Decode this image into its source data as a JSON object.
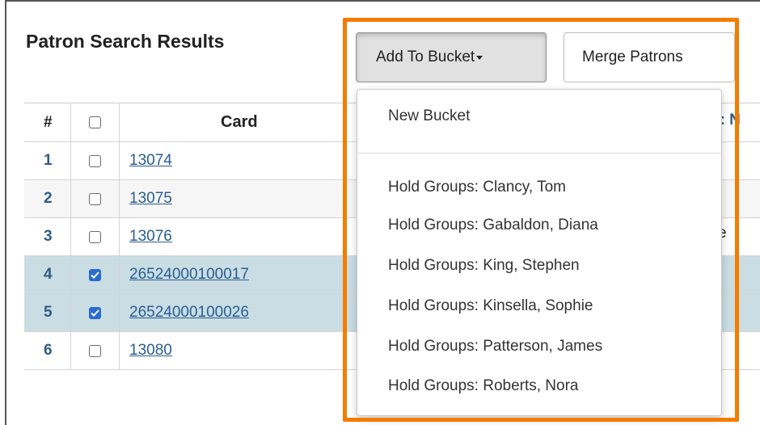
{
  "page": {
    "title": "Patron Search Results"
  },
  "toolbar": {
    "add_to_bucket_label": "Add To Bucket",
    "merge_patrons_label": "Merge Patrons"
  },
  "table": {
    "headers": {
      "num": "#",
      "card": "Card",
      "partial_next_column": "s: N"
    },
    "rows": [
      {
        "num": "1",
        "card": "13074",
        "checked": false
      },
      {
        "num": "2",
        "card": "13075",
        "checked": false
      },
      {
        "num": "3",
        "card": "13076",
        "checked": false
      },
      {
        "num": "4",
        "card": "26524000100017",
        "checked": true
      },
      {
        "num": "5",
        "card": "26524000100026",
        "checked": true
      },
      {
        "num": "6",
        "card": "13080",
        "checked": false
      }
    ],
    "partial_cell_text": "e"
  },
  "dropdown": {
    "new_bucket": "New Bucket",
    "items": [
      "Hold Groups: Clancy, Tom",
      "Hold Groups: Gabaldon, Diana",
      "Hold Groups: King, Stephen",
      "Hold Groups: Kinsella, Sophie",
      "Hold Groups: Patterson, James",
      "Hold Groups: Roberts, Nora"
    ]
  },
  "icons": {
    "caret": "caret-down-icon",
    "checkbox": "checkbox-icon"
  },
  "colors": {
    "highlight": "#f57c00",
    "selected_row": "#c9dde3",
    "link": "#2a5e92",
    "checkbox_checked": "#2a6bd0"
  }
}
